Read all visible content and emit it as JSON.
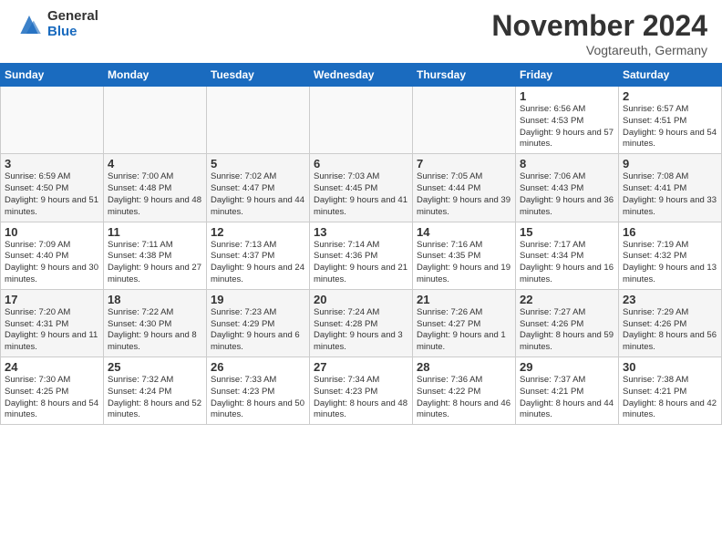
{
  "logo": {
    "general": "General",
    "blue": "Blue"
  },
  "title": "November 2024",
  "location": "Vogtareuth, Germany",
  "days_of_week": [
    "Sunday",
    "Monday",
    "Tuesday",
    "Wednesday",
    "Thursday",
    "Friday",
    "Saturday"
  ],
  "weeks": [
    [
      {
        "day": "",
        "info": ""
      },
      {
        "day": "",
        "info": ""
      },
      {
        "day": "",
        "info": ""
      },
      {
        "day": "",
        "info": ""
      },
      {
        "day": "",
        "info": ""
      },
      {
        "day": "1",
        "info": "Sunrise: 6:56 AM\nSunset: 4:53 PM\nDaylight: 9 hours and 57 minutes."
      },
      {
        "day": "2",
        "info": "Sunrise: 6:57 AM\nSunset: 4:51 PM\nDaylight: 9 hours and 54 minutes."
      }
    ],
    [
      {
        "day": "3",
        "info": "Sunrise: 6:59 AM\nSunset: 4:50 PM\nDaylight: 9 hours and 51 minutes."
      },
      {
        "day": "4",
        "info": "Sunrise: 7:00 AM\nSunset: 4:48 PM\nDaylight: 9 hours and 48 minutes."
      },
      {
        "day": "5",
        "info": "Sunrise: 7:02 AM\nSunset: 4:47 PM\nDaylight: 9 hours and 44 minutes."
      },
      {
        "day": "6",
        "info": "Sunrise: 7:03 AM\nSunset: 4:45 PM\nDaylight: 9 hours and 41 minutes."
      },
      {
        "day": "7",
        "info": "Sunrise: 7:05 AM\nSunset: 4:44 PM\nDaylight: 9 hours and 39 minutes."
      },
      {
        "day": "8",
        "info": "Sunrise: 7:06 AM\nSunset: 4:43 PM\nDaylight: 9 hours and 36 minutes."
      },
      {
        "day": "9",
        "info": "Sunrise: 7:08 AM\nSunset: 4:41 PM\nDaylight: 9 hours and 33 minutes."
      }
    ],
    [
      {
        "day": "10",
        "info": "Sunrise: 7:09 AM\nSunset: 4:40 PM\nDaylight: 9 hours and 30 minutes."
      },
      {
        "day": "11",
        "info": "Sunrise: 7:11 AM\nSunset: 4:38 PM\nDaylight: 9 hours and 27 minutes."
      },
      {
        "day": "12",
        "info": "Sunrise: 7:13 AM\nSunset: 4:37 PM\nDaylight: 9 hours and 24 minutes."
      },
      {
        "day": "13",
        "info": "Sunrise: 7:14 AM\nSunset: 4:36 PM\nDaylight: 9 hours and 21 minutes."
      },
      {
        "day": "14",
        "info": "Sunrise: 7:16 AM\nSunset: 4:35 PM\nDaylight: 9 hours and 19 minutes."
      },
      {
        "day": "15",
        "info": "Sunrise: 7:17 AM\nSunset: 4:34 PM\nDaylight: 9 hours and 16 minutes."
      },
      {
        "day": "16",
        "info": "Sunrise: 7:19 AM\nSunset: 4:32 PM\nDaylight: 9 hours and 13 minutes."
      }
    ],
    [
      {
        "day": "17",
        "info": "Sunrise: 7:20 AM\nSunset: 4:31 PM\nDaylight: 9 hours and 11 minutes."
      },
      {
        "day": "18",
        "info": "Sunrise: 7:22 AM\nSunset: 4:30 PM\nDaylight: 9 hours and 8 minutes."
      },
      {
        "day": "19",
        "info": "Sunrise: 7:23 AM\nSunset: 4:29 PM\nDaylight: 9 hours and 6 minutes."
      },
      {
        "day": "20",
        "info": "Sunrise: 7:24 AM\nSunset: 4:28 PM\nDaylight: 9 hours and 3 minutes."
      },
      {
        "day": "21",
        "info": "Sunrise: 7:26 AM\nSunset: 4:27 PM\nDaylight: 9 hours and 1 minute."
      },
      {
        "day": "22",
        "info": "Sunrise: 7:27 AM\nSunset: 4:26 PM\nDaylight: 8 hours and 59 minutes."
      },
      {
        "day": "23",
        "info": "Sunrise: 7:29 AM\nSunset: 4:26 PM\nDaylight: 8 hours and 56 minutes."
      }
    ],
    [
      {
        "day": "24",
        "info": "Sunrise: 7:30 AM\nSunset: 4:25 PM\nDaylight: 8 hours and 54 minutes."
      },
      {
        "day": "25",
        "info": "Sunrise: 7:32 AM\nSunset: 4:24 PM\nDaylight: 8 hours and 52 minutes."
      },
      {
        "day": "26",
        "info": "Sunrise: 7:33 AM\nSunset: 4:23 PM\nDaylight: 8 hours and 50 minutes."
      },
      {
        "day": "27",
        "info": "Sunrise: 7:34 AM\nSunset: 4:23 PM\nDaylight: 8 hours and 48 minutes."
      },
      {
        "day": "28",
        "info": "Sunrise: 7:36 AM\nSunset: 4:22 PM\nDaylight: 8 hours and 46 minutes."
      },
      {
        "day": "29",
        "info": "Sunrise: 7:37 AM\nSunset: 4:21 PM\nDaylight: 8 hours and 44 minutes."
      },
      {
        "day": "30",
        "info": "Sunrise: 7:38 AM\nSunset: 4:21 PM\nDaylight: 8 hours and 42 minutes."
      }
    ]
  ]
}
